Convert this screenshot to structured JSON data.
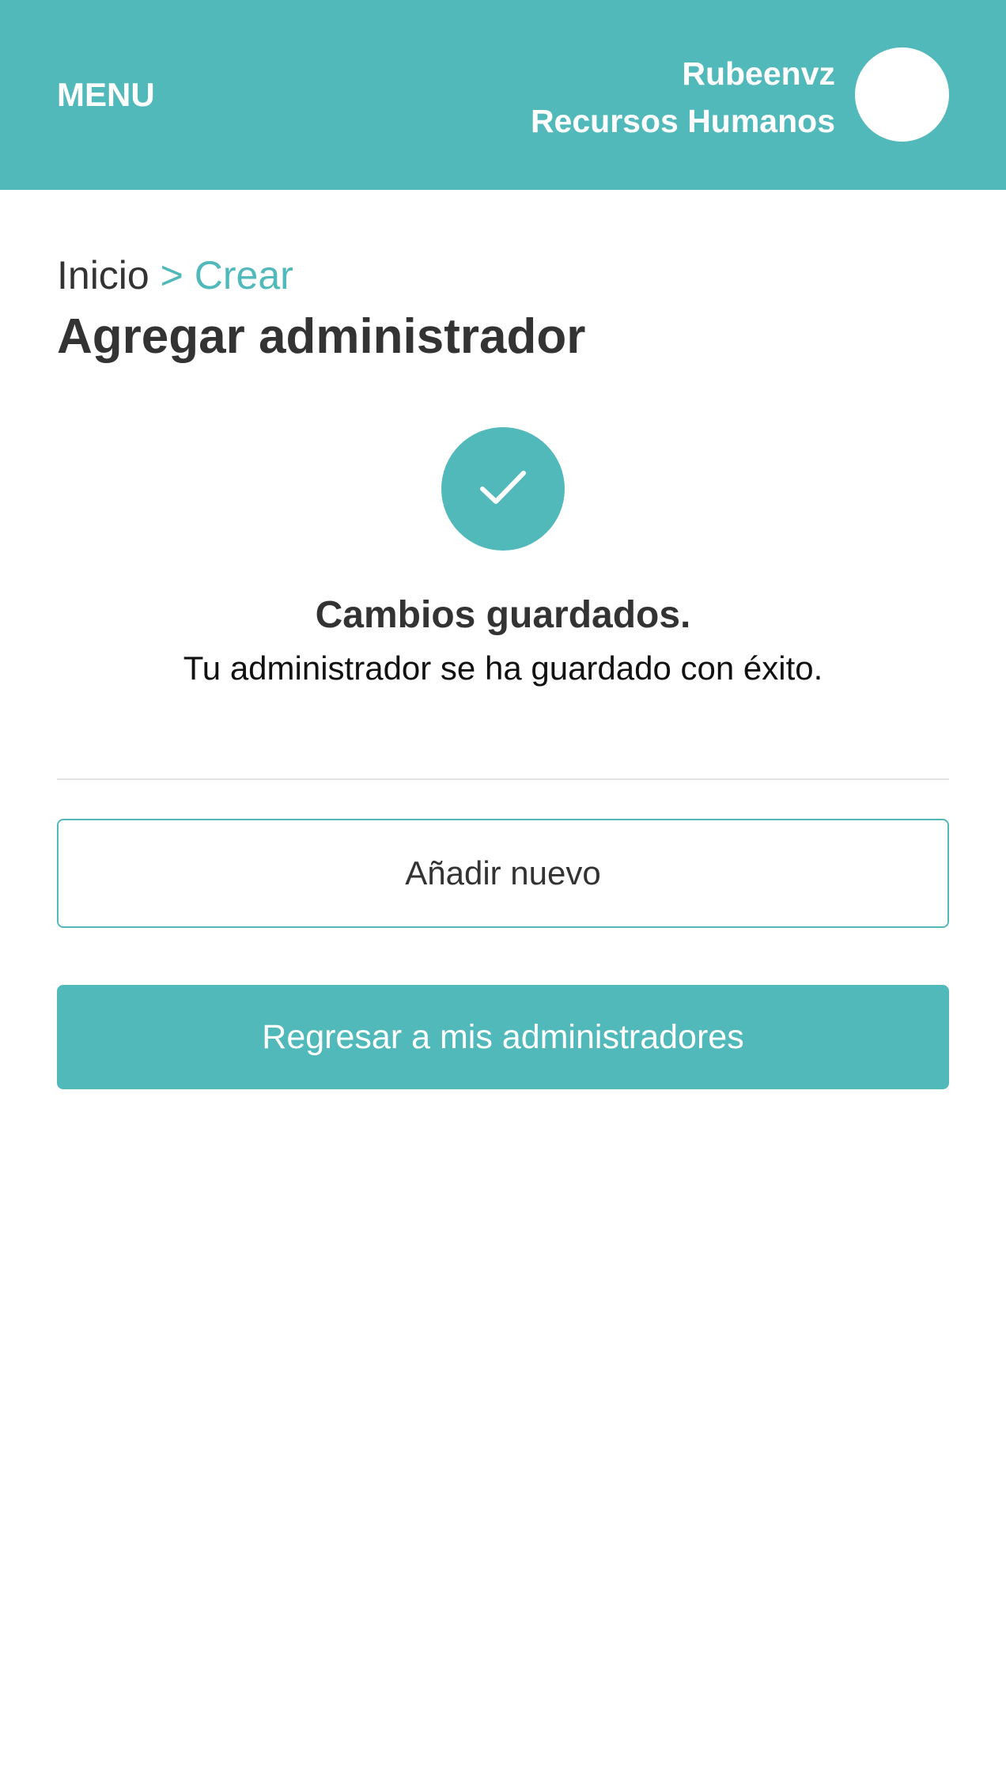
{
  "header": {
    "menu_label": "MENU",
    "user_name": "Rubeenvz",
    "user_department": "Recursos Humanos",
    "avatar_icon": "avatar-circle"
  },
  "breadcrumb": {
    "home": "Inicio",
    "separator": ">",
    "current": "Crear"
  },
  "page": {
    "title": "Agregar administrador"
  },
  "success": {
    "icon": "checkmark-icon",
    "title": "Cambios guardados.",
    "message": "Tu administrador se ha guardado con éxito."
  },
  "actions": {
    "add_new_label": "Añadir nuevo",
    "back_label": "Regresar a mis administradores"
  },
  "colors": {
    "accent": "#52b9bb",
    "text_dark": "#333333",
    "divider": "#e2e2e2"
  }
}
